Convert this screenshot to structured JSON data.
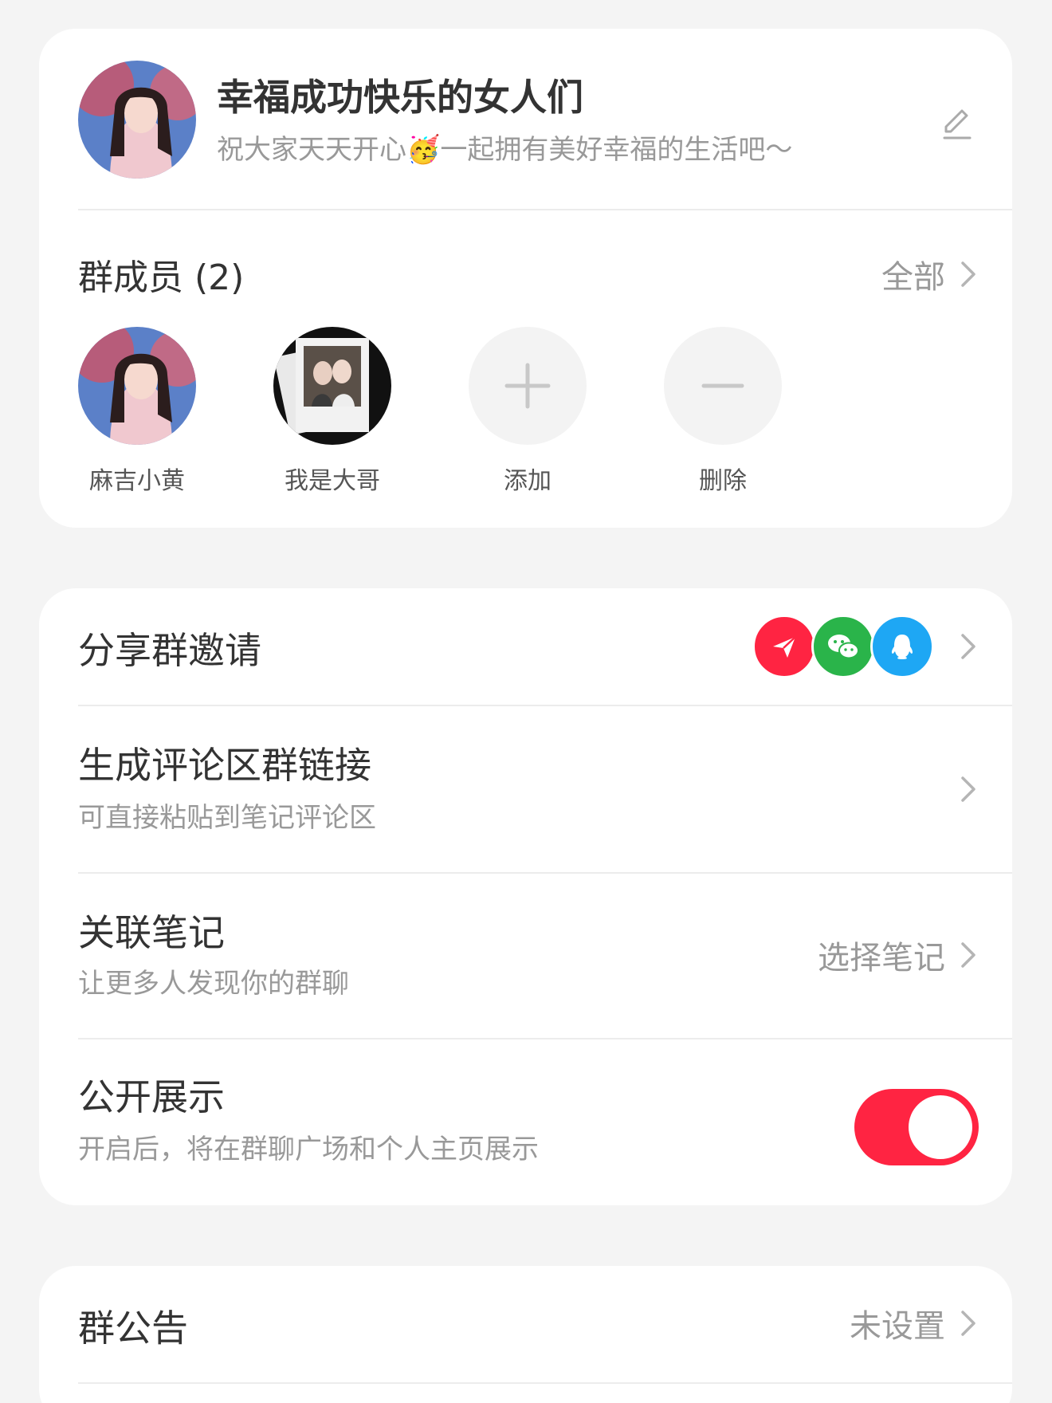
{
  "group": {
    "name": "幸福成功快乐的女人们",
    "description_before": "祝大家天天开心",
    "description_emoji": "🥳",
    "description_after": "一起拥有美好幸福的生活吧～"
  },
  "members_section": {
    "title": "群成员 (2)",
    "all_label": "全部",
    "members": [
      {
        "name": "麻吉小黄"
      },
      {
        "name": "我是大哥"
      }
    ],
    "add_label": "添加",
    "remove_label": "删除"
  },
  "settings": {
    "share_invite": {
      "title": "分享群邀请",
      "icons": [
        "send-icon",
        "wechat-icon",
        "qq-icon"
      ],
      "colors": {
        "send": "#ff2442",
        "wechat": "#2ab44a",
        "qq": "#1ea7f4"
      }
    },
    "comment_link": {
      "title": "生成评论区群链接",
      "subtitle": "可直接粘贴到笔记评论区"
    },
    "link_note": {
      "title": "关联笔记",
      "subtitle": "让更多人发现你的群聊",
      "action": "选择笔记"
    },
    "public_display": {
      "title": "公开展示",
      "subtitle": "开启后，将在群聊广场和个人主页展示",
      "enabled": true,
      "accent": "#ff2442"
    }
  },
  "announcement": {
    "title": "群公告",
    "value": "未设置"
  }
}
